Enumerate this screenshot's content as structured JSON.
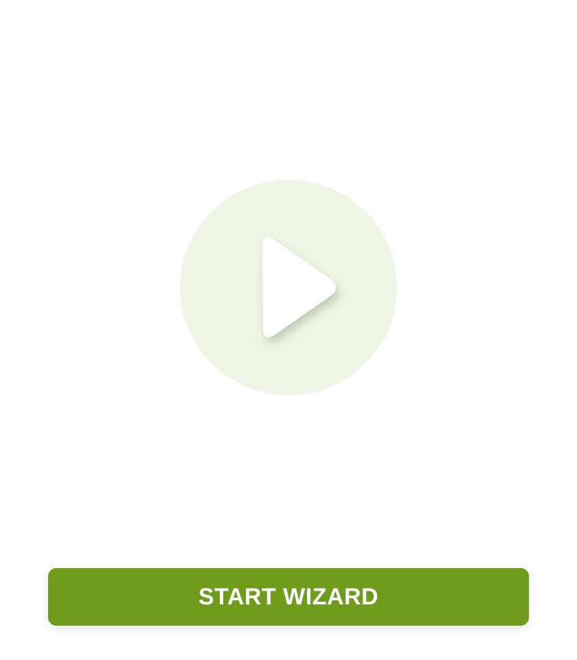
{
  "colors": {
    "background": "#ffffff",
    "play_circle": "#f0f6e5",
    "play_triangle": "#ffffff",
    "primary": "#6f9c1a",
    "button_text": "#ffffff"
  },
  "play": {
    "icon": "play-icon"
  },
  "actions": {
    "start_label": "START WIZARD"
  }
}
